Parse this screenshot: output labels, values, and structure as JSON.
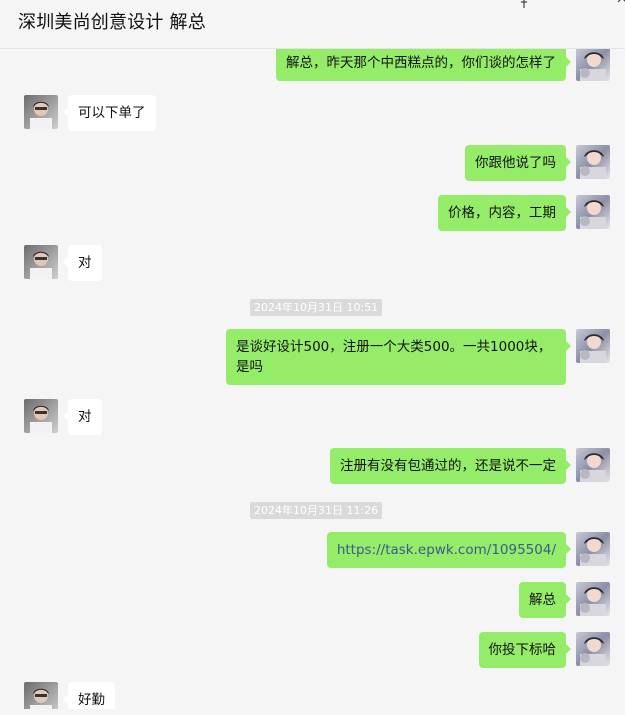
{
  "window": {
    "title": "深圳美尚创意设计 解总",
    "controls": [
      "pin-icon",
      "minimize-icon",
      "maximize-icon",
      "close-icon"
    ]
  },
  "messages": [
    {
      "side": "out",
      "text": "解总，昨天那个中西糕点的，你们谈的怎样了"
    },
    {
      "side": "in",
      "text": "可以下单了"
    },
    {
      "side": "out",
      "text": "你跟他说了吗"
    },
    {
      "side": "out",
      "text": "价格，内容，工期"
    },
    {
      "side": "in",
      "text": "对"
    },
    {
      "side": "time",
      "text": "2024年10月31日 10:51"
    },
    {
      "side": "out",
      "text": "是谈好设计500，注册一个大类500。一共1000块，是吗"
    },
    {
      "side": "in",
      "text": "对"
    },
    {
      "side": "out",
      "text": "注册有没有包通过的，还是说不一定"
    },
    {
      "side": "time",
      "text": "2024年10月31日 11:26"
    },
    {
      "side": "out",
      "text": "https://task.epwk.com/1095504/",
      "type": "link"
    },
    {
      "side": "out",
      "text": "解总"
    },
    {
      "side": "out",
      "text": "你投下标哈"
    },
    {
      "side": "in",
      "text": "好勤"
    }
  ],
  "colors": {
    "outgoing_bubble": "#95ec69",
    "incoming_bubble": "#ffffff",
    "background": "#f5f5f5",
    "link": "#3b5b8c"
  }
}
